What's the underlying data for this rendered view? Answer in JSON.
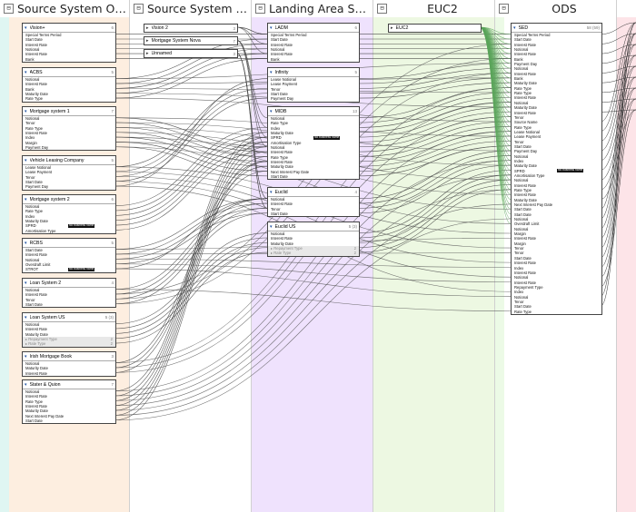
{
  "lanes": [
    {
      "title": "Source System On ...",
      "bg": "#fdeee0"
    },
    {
      "title": "Source System Cloud",
      "bg": "#ffffff"
    },
    {
      "title": "Landing Area Syste...",
      "bg": "#efe2fd"
    },
    {
      "title": "EUC2",
      "bg": "#edf8e2"
    },
    {
      "title": "ODS",
      "bg": "#ffffff"
    },
    {
      "title": "",
      "bg": "#fde4e8"
    }
  ],
  "business_name_label": "No business name",
  "nodes": [
    {
      "id": "vision_plus",
      "name": "Vision+",
      "count": "6",
      "rows": [
        "Special Terms Period",
        "Start Date",
        "Interest Rate",
        "Notional",
        "Interest Rate",
        "Bank"
      ]
    },
    {
      "id": "acbs",
      "name": "ACBS",
      "count": "5",
      "rows": [
        "Notional",
        "Interest Rate",
        "Bank",
        "Maturity Date",
        "Rate Type"
      ]
    },
    {
      "id": "mortgage1",
      "name": "Mortgage system 1",
      "count": "7",
      "rows": [
        "Notional",
        "Tenor",
        "Rate Type",
        "Interest Rate",
        "Index",
        "Margin",
        "Payment Day"
      ]
    },
    {
      "id": "vehicle",
      "name": "Vehicle Leasing Company",
      "count": "5",
      "rows": [
        "Lease Notional",
        "Lease Payment",
        "Tenor",
        "Start Date",
        "Payment Day"
      ]
    },
    {
      "id": "mortgage2",
      "name": "Mortgage system 2",
      "count": "6",
      "rows": [
        "Notional",
        "Rate Type",
        "Index",
        "Maturity Date",
        "SPRD",
        "Amortisation Type"
      ]
    },
    {
      "id": "rcbs",
      "name": "RCBS",
      "count": "5",
      "rows": [
        "Start Date",
        "Interest Rate",
        "Notional",
        "Overdraft Limit",
        "STROT"
      ]
    },
    {
      "id": "loan2",
      "name": "Loan System 2",
      "count": "4",
      "rows": [
        "Notional",
        "Interest Rate",
        "Tenor",
        "Start Date"
      ]
    },
    {
      "id": "loanus",
      "name": "Loan System US",
      "count": "5 (3)",
      "rows": [
        "Notional",
        "Interest Rate",
        "Maturity Date"
      ],
      "groups": [
        {
          "label": "Repayment Type",
          "count": "2"
        },
        {
          "label": "Rate Type",
          "count": "2"
        }
      ]
    },
    {
      "id": "irish",
      "name": "Irish Mortgage Book",
      "count": "3",
      "rows": [
        "Notional",
        "Maturity Date",
        "Interest Rate"
      ]
    },
    {
      "id": "stater",
      "name": "Stater & Quion",
      "count": "7",
      "rows": [
        "Notional",
        "Interest Rate",
        "Rate Type",
        "Interest Rate",
        "Maturity Date",
        "Next Interest Pay Date",
        "Start Date"
      ]
    },
    {
      "id": "vision2",
      "name": "Vision 2",
      "count": "3",
      "collapsed": true
    },
    {
      "id": "mortgage_nova",
      "name": "Mortgage System Nova",
      "count": "7",
      "collapsed": true
    },
    {
      "id": "unnamed",
      "name": "Unnamed",
      "count": "3",
      "collapsed": true
    },
    {
      "id": "ladm",
      "name": "LADM",
      "count": "6",
      "rows": [
        "Special Terms Period",
        "Start Date",
        "Interest Rate",
        "Notional",
        "Interest Rate",
        "Bank"
      ]
    },
    {
      "id": "infinity",
      "name": "Infinity",
      "count": "5",
      "rows": [
        "Lease Notional",
        "Lease Payment",
        "Tenor",
        "Start Date",
        "Payment Day"
      ]
    },
    {
      "id": "midb",
      "name": "MIDB",
      "count": "13",
      "rows": [
        "Notional",
        "Rate Type",
        "Index",
        "Maturity Date",
        "SPRD",
        "Amortisation Type",
        "Notional",
        "Interest Rate",
        "Rate Type",
        "Interest Rate",
        "Maturity Date",
        "Next Interest Pay Date",
        "Start Date"
      ]
    },
    {
      "id": "euclid",
      "name": "Euclid",
      "count": "4",
      "rows": [
        "Notional",
        "Interest Rate",
        "Tenor",
        "Start Date"
      ]
    },
    {
      "id": "euclidus",
      "name": "Euclid US",
      "count": "5 (3)",
      "rows": [
        "Notional",
        "Interest Rate",
        "Maturity Date"
      ],
      "groups": [
        {
          "label": "Repayment Type",
          "count": "2"
        },
        {
          "label": "Rate Type",
          "count": "2"
        }
      ]
    },
    {
      "id": "euc2",
      "name": "EUC2",
      "count": "",
      "collapsed": true
    },
    {
      "id": "sed",
      "name": "SED",
      "count": "58 (59)",
      "rows": [
        "Special Terms Period",
        "Start Date",
        "Interest Rate",
        "Notional",
        "Interest Rate",
        "Bank",
        "Payment Day",
        "Notional",
        "Interest Rate",
        "Bank",
        "Maturity Date",
        "Rate Type",
        "Rate Type",
        "Interest Rate",
        "Notional",
        "Maturity Date",
        "Interest Rate",
        "Tenor",
        "Source Name",
        "Rate Type",
        "Lease Notional",
        "Lease Payment",
        "Tenor",
        "Start Date",
        "Payment Day",
        "Notional",
        "Index",
        "Maturity Date",
        "SPRD",
        "Amortisation Type",
        "Notional",
        "Interest Rate",
        "Rate Type",
        "Interest Rate",
        "Maturity Date",
        "Next Interest Pay Date",
        "Start Date",
        "Start Date",
        "Notional",
        "Overdraft Limit",
        "Notional",
        "Margin",
        "Interest Rate",
        "Margin",
        "Tenor",
        "Tenor",
        "Start Date",
        "Interest Rate",
        "Index",
        "Interest Rate",
        "Notional",
        "Interest Rate",
        "Repayment Type",
        "Index",
        "Notional",
        "Tenor",
        "Start Date",
        "Rate Type"
      ]
    }
  ]
}
